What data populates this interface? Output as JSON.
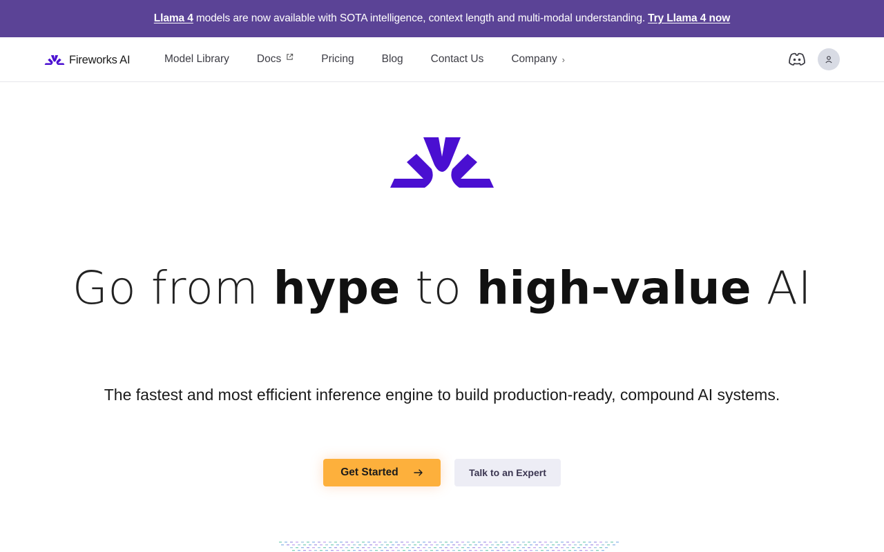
{
  "announcement": {
    "link1": "Llama 4",
    "text": "models are now available with SOTA intelligence, context length and multi-modal understanding.",
    "link2": "Try Llama 4 now",
    "bg_color": "#5b4396"
  },
  "nav": {
    "brand": "Fireworks AI",
    "items": [
      {
        "label": "Model Library"
      },
      {
        "label": "Docs",
        "icon": "external-link-icon"
      },
      {
        "label": "Pricing"
      },
      {
        "label": "Blog"
      },
      {
        "label": "Contact Us"
      },
      {
        "label": "Company",
        "icon": "chevron-right-icon"
      }
    ],
    "right_icons": [
      "discord-icon",
      "user-icon"
    ]
  },
  "hero": {
    "headline": {
      "w1": "Go from",
      "w2": "hype",
      "w3": "to",
      "w4": "high-value",
      "w5": "AI"
    },
    "subheadline": "The fastest and most efficient inference engine to build production-ready, compound AI systems.",
    "primary_button": "Get Started",
    "secondary_button": "Talk to an Expert"
  },
  "colors": {
    "brand_purple": "#4a0fd1",
    "accent_orange": "#fdb03c",
    "secondary_button_bg": "#ededf5"
  }
}
